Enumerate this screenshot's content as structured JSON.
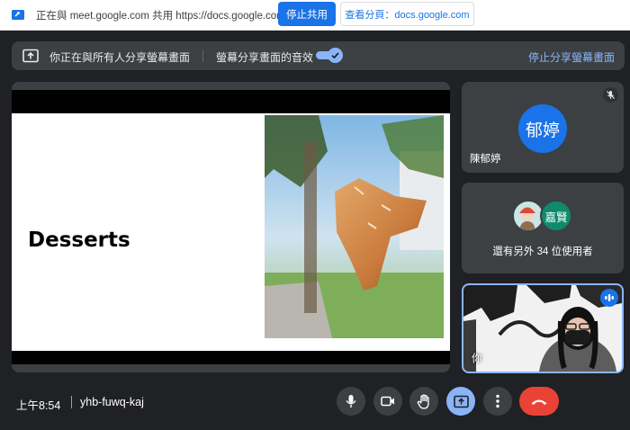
{
  "share_bar": {
    "message": "正在與 meet.google.com 共用 https://docs.google.com",
    "stop_button": "停止共用",
    "view_button": "查看分頁：docs.google.com"
  },
  "banner": {
    "presenting_text": "你正在與所有人分享螢幕畫面",
    "audio_text": "螢幕分享畫面的音效",
    "audio_toggle_on": true,
    "stop_link": "停止分享螢幕畫面"
  },
  "presentation": {
    "slide_title": "Desserts"
  },
  "participants": [
    {
      "name": "陳郁婷",
      "avatar_text": "郁婷",
      "muted": true,
      "avatar_color": "#1a73e8"
    },
    {
      "avatar_text": "嘉賢",
      "avatar_color": "#0f8a6d",
      "others_text": "還有另外 34 位使用者"
    },
    {
      "name": "你",
      "speaking": true
    }
  ],
  "meeting": {
    "time": "上午8:54",
    "code": "yhb-fuwq-kaj"
  },
  "controls": [
    "mic-icon",
    "camera-icon",
    "raise-hand-icon",
    "present-icon",
    "more-options-icon",
    "hang-up-icon"
  ],
  "colors": {
    "accent": "#1a73e8",
    "link": "#8ab4f8",
    "leave": "#ea4335",
    "surface": "#3c4043",
    "background": "#202124"
  }
}
